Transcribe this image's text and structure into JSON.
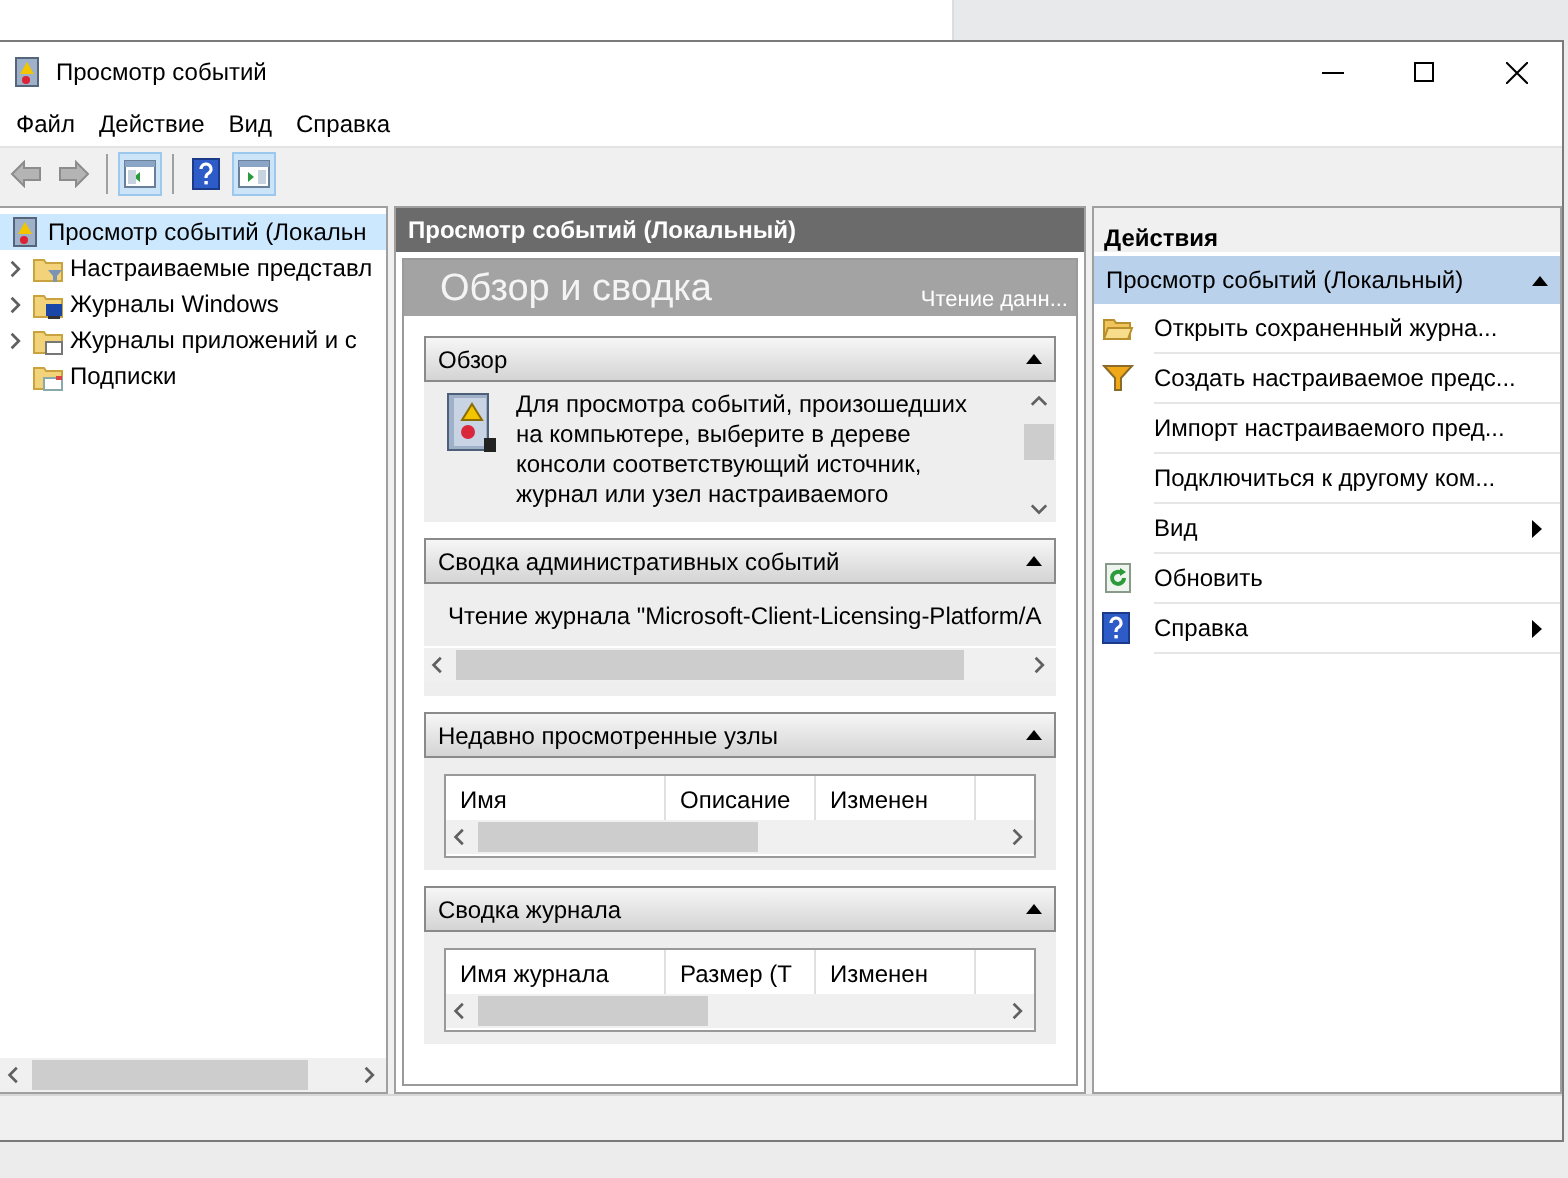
{
  "window": {
    "title": "Просмотр событий"
  },
  "menu": [
    "Файл",
    "Действие",
    "Вид",
    "Справка"
  ],
  "toolbar": [
    {
      "kind": "back",
      "disabled": true
    },
    {
      "kind": "forward",
      "disabled": true
    },
    {
      "kind": "separator"
    },
    {
      "kind": "tree-toggle",
      "selected": true
    },
    {
      "kind": "separator"
    },
    {
      "kind": "help",
      "selected": false
    },
    {
      "kind": "actions-toggle",
      "selected": true
    }
  ],
  "tree": [
    {
      "label": "Просмотр событий (Локальн",
      "kind": "viewer",
      "selected": true,
      "children": [
        {
          "label": "Настраиваемые представл",
          "kind": "filter-folder",
          "selected": false,
          "expandable": true
        },
        {
          "label": "Журналы Windows",
          "kind": "monitor-folder",
          "selected": false,
          "expandable": true
        },
        {
          "label": "Журналы приложений и с",
          "kind": "app-folder",
          "selected": false,
          "expandable": true
        },
        {
          "label": "Подписки",
          "kind": "subscription-folder",
          "selected": false,
          "expandable": false
        }
      ]
    }
  ],
  "center": {
    "header": "Просмотр событий (Локальный)",
    "title": "Обзор и сводка",
    "status": "Чтение данн...",
    "sections": [
      {
        "kind": "text",
        "title": "Обзор",
        "expanded": true,
        "text": "Для просмотра событий, произошедших на компьютере, выберите в дереве консоли соответствующий источник, журнал или узел настраиваемого"
      },
      {
        "kind": "line",
        "title": "Сводка административных событий",
        "expanded": true,
        "text": "Чтение журнала \"Microsoft-Client-Licensing-Platform/A"
      },
      {
        "kind": "table",
        "title": "Недавно просмотренные узлы",
        "expanded": true,
        "columns": [
          "Имя",
          "Описание",
          "Изменен"
        ]
      },
      {
        "kind": "table",
        "title": "Сводка журнала",
        "expanded": true,
        "columns": [
          "Имя журнала",
          "Размер (Т",
          "Изменен"
        ]
      }
    ]
  },
  "actions": {
    "header": "Действия",
    "group": {
      "label": "Просмотр событий (Локальный)",
      "expanded": true
    },
    "items": [
      {
        "label": "Открыть сохраненный журна...",
        "kind": "folder",
        "submenu": false
      },
      {
        "label": "Создать настраиваемое предс...",
        "kind": "filter",
        "submenu": false
      },
      {
        "label": "Импорт настраиваемого пред...",
        "kind": "plain",
        "submenu": false
      },
      {
        "label": "Подключиться к другому ком...",
        "kind": "plain",
        "submenu": false
      },
      {
        "label": "Вид",
        "kind": "plain",
        "submenu": true
      },
      {
        "label": "Обновить",
        "kind": "refresh",
        "submenu": false
      },
      {
        "label": "Справка",
        "kind": "help",
        "submenu": true
      }
    ]
  }
}
